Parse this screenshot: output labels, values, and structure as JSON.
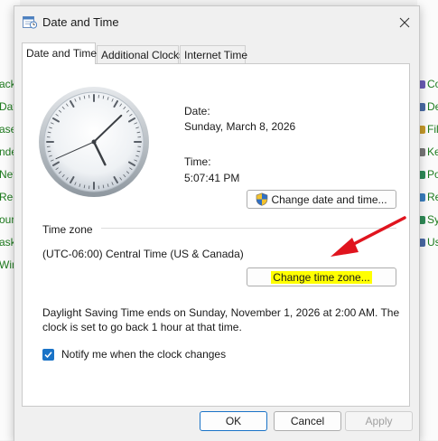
{
  "background": {
    "left_items": [
      "ack",
      "Date",
      "ase",
      "nde",
      "Netv",
      "Reco",
      "our",
      "ask",
      "Win"
    ],
    "right_items": [
      {
        "label": "Co",
        "icon": "computer-icon",
        "color": "#6b5bb5"
      },
      {
        "label": "De",
        "icon": "device-icon",
        "color": "#4a6aa5"
      },
      {
        "label": "Fil",
        "icon": "folder-icon",
        "color": "#c59a2a"
      },
      {
        "label": "Ke",
        "icon": "keyboard-icon",
        "color": "#777777"
      },
      {
        "label": "Po",
        "icon": "power-icon",
        "color": "#2e8b57"
      },
      {
        "label": "Re",
        "icon": "recovery-icon",
        "color": "#3a7fbf"
      },
      {
        "label": "Sy",
        "icon": "system-icon",
        "color": "#2e8b57"
      },
      {
        "label": "Us",
        "icon": "users-icon",
        "color": "#4a6aa5"
      }
    ]
  },
  "dialog": {
    "title": "Date and Time",
    "tabs": [
      {
        "label": "Date and Time",
        "active": true
      },
      {
        "label": "Additional Clocks",
        "active": false
      },
      {
        "label": "Internet Time",
        "active": false
      }
    ],
    "date_label": "Date:",
    "date_value": "Sunday, March 8, 2026",
    "time_label": "Time:",
    "time_value": "5:07:41 PM",
    "clock": {
      "hour": 5,
      "minute": 7,
      "second": 41
    },
    "change_date_button": "Change date and time...",
    "timezone_section_label": "Time zone",
    "timezone_value": "(UTC-06:00) Central Time (US & Canada)",
    "change_timezone_button": "Change time zone...",
    "dst_text_line1": "Daylight Saving Time ends on Sunday, November 1, 2026 at 2:00 AM. The",
    "dst_text_line2": "clock is set to go back 1 hour at that time.",
    "notify_checkbox": {
      "label": "Notify me when the clock changes",
      "checked": true
    },
    "ok_button": "OK",
    "cancel_button": "Cancel",
    "apply_button": "Apply",
    "highlight_color": "#ffff00",
    "arrow_color": "#e0141e"
  }
}
